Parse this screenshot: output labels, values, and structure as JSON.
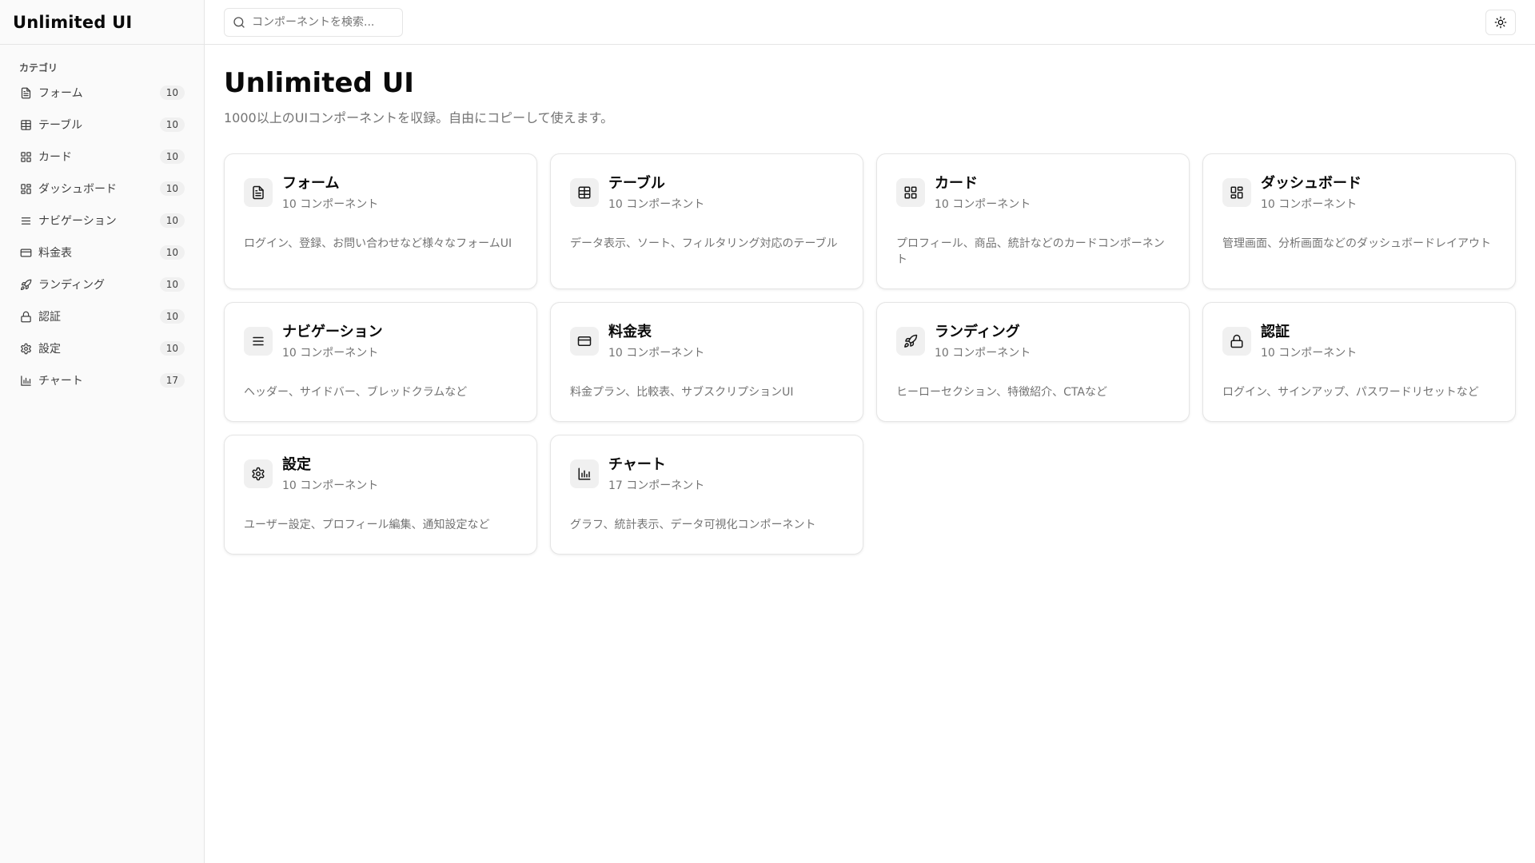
{
  "app": {
    "brand": "Unlimited UI"
  },
  "sidebar": {
    "group_label": "カテゴリ",
    "items": [
      {
        "label": "フォーム",
        "count": "10",
        "icon": "file-text-icon"
      },
      {
        "label": "テーブル",
        "count": "10",
        "icon": "table-icon"
      },
      {
        "label": "カード",
        "count": "10",
        "icon": "grid-icon"
      },
      {
        "label": "ダッシュボード",
        "count": "10",
        "icon": "dashboard-icon"
      },
      {
        "label": "ナビゲーション",
        "count": "10",
        "icon": "menu-icon"
      },
      {
        "label": "料金表",
        "count": "10",
        "icon": "credit-card-icon"
      },
      {
        "label": "ランディング",
        "count": "10",
        "icon": "rocket-icon"
      },
      {
        "label": "認証",
        "count": "10",
        "icon": "lock-icon"
      },
      {
        "label": "設定",
        "count": "10",
        "icon": "gear-icon"
      },
      {
        "label": "チャート",
        "count": "17",
        "icon": "bar-chart-icon"
      }
    ]
  },
  "topbar": {
    "search_placeholder": "コンポーネントを検索...",
    "theme_toggle_icon": "sun-icon"
  },
  "main": {
    "title": "Unlimited UI",
    "subtitle": "1000以上のUIコンポーネントを収録。自由にコピーして使えます。",
    "cards": [
      {
        "title": "フォーム",
        "count": "10 コンポーネント",
        "desc": "ログイン、登録、お問い合わせなど様々なフォームUI",
        "icon": "file-text-icon"
      },
      {
        "title": "テーブル",
        "count": "10 コンポーネント",
        "desc": "データ表示、ソート、フィルタリング対応のテーブル",
        "icon": "table-icon"
      },
      {
        "title": "カード",
        "count": "10 コンポーネント",
        "desc": "プロフィール、商品、統計などのカードコンポーネント",
        "icon": "grid-icon"
      },
      {
        "title": "ダッシュボード",
        "count": "10 コンポーネント",
        "desc": "管理画面、分析画面などのダッシュボードレイアウト",
        "icon": "dashboard-icon"
      },
      {
        "title": "ナビゲーション",
        "count": "10 コンポーネント",
        "desc": "ヘッダー、サイドバー、ブレッドクラムなど",
        "icon": "menu-icon"
      },
      {
        "title": "料金表",
        "count": "10 コンポーネント",
        "desc": "料金プラン、比較表、サブスクリプションUI",
        "icon": "credit-card-icon"
      },
      {
        "title": "ランディング",
        "count": "10 コンポーネント",
        "desc": "ヒーローセクション、特徴紹介、CTAなど",
        "icon": "rocket-icon"
      },
      {
        "title": "認証",
        "count": "10 コンポーネント",
        "desc": "ログイン、サインアップ、パスワードリセットなど",
        "icon": "lock-icon"
      },
      {
        "title": "設定",
        "count": "10 コンポーネント",
        "desc": "ユーザー設定、プロフィール編集、通知設定など",
        "icon": "gear-icon"
      },
      {
        "title": "チャート",
        "count": "17 コンポーネント",
        "desc": "グラフ、統計表示、データ可視化コンポーネント",
        "icon": "bar-chart-icon"
      }
    ]
  }
}
